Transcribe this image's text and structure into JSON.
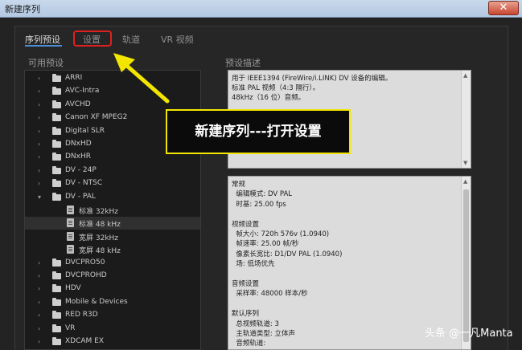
{
  "window": {
    "title": "新建序列",
    "close_glyph": "✕"
  },
  "tabs": [
    {
      "label": "序列预设"
    },
    {
      "label": "设置"
    },
    {
      "label": "轨道"
    },
    {
      "label": "VR 视频"
    }
  ],
  "presets": {
    "label": "可用预设",
    "items": [
      {
        "label": "ARRI",
        "type": "folder",
        "level": 0,
        "expanded": false
      },
      {
        "label": "AVC-Intra",
        "type": "folder",
        "level": 0,
        "expanded": false
      },
      {
        "label": "AVCHD",
        "type": "folder",
        "level": 0,
        "expanded": false
      },
      {
        "label": "Canon XF MPEG2",
        "type": "folder",
        "level": 0,
        "expanded": false
      },
      {
        "label": "Digital SLR",
        "type": "folder",
        "level": 0,
        "expanded": false
      },
      {
        "label": "DNxHD",
        "type": "folder",
        "level": 0,
        "expanded": false
      },
      {
        "label": "DNxHR",
        "type": "folder",
        "level": 0,
        "expanded": false
      },
      {
        "label": "DV - 24P",
        "type": "folder",
        "level": 0,
        "expanded": false
      },
      {
        "label": "DV - NTSC",
        "type": "folder",
        "level": 0,
        "expanded": false
      },
      {
        "label": "DV - PAL",
        "type": "folder",
        "level": 0,
        "expanded": true
      },
      {
        "label": "标准 32kHz",
        "type": "file",
        "level": 1
      },
      {
        "label": "标准 48 kHz",
        "type": "file",
        "level": 1,
        "selected": true
      },
      {
        "label": "宽屏 32kHz",
        "type": "file",
        "level": 1
      },
      {
        "label": "宽屏 48 kHz",
        "type": "file",
        "level": 1
      },
      {
        "label": "DVCPRO50",
        "type": "folder",
        "level": 0,
        "expanded": false
      },
      {
        "label": "DVCPROHD",
        "type": "folder",
        "level": 0,
        "expanded": false
      },
      {
        "label": "HDV",
        "type": "folder",
        "level": 0,
        "expanded": false
      },
      {
        "label": "Mobile & Devices",
        "type": "folder",
        "level": 0,
        "expanded": false
      },
      {
        "label": "RED R3D",
        "type": "folder",
        "level": 0,
        "expanded": false
      },
      {
        "label": "VR",
        "type": "folder",
        "level": 0,
        "expanded": false
      },
      {
        "label": "XDCAM EX",
        "type": "folder",
        "level": 0,
        "expanded": false
      }
    ]
  },
  "description": {
    "label": "预设描述",
    "lines": [
      "用于 IEEE1394 (FireWire/i.LINK) DV 设备的编辑。",
      "标准 PAL 视频（4:3 隔行）。",
      "48kHz（16 位）音频。"
    ]
  },
  "details": {
    "lines": [
      "常规",
      "  编辑模式: DV PAL",
      "  时基: 25.00 fps",
      "",
      "视频设置",
      "  帧大小: 720h 576v (1.0940)",
      "  帧速率: 25.00  帧/秒",
      "  像素长宽比: D1/DV PAL (1.0940)",
      "  场: 低场优先",
      "",
      "音频设置",
      "  采样率: 48000 样本/秒",
      "",
      "默认序列",
      "  总视频轨道: 3",
      "  主轨道类型: 立体声",
      "  音频轨道:"
    ]
  },
  "annotation": {
    "text": "新建序列---打开设置",
    "arrow_color": "#f2e600",
    "highlight_color": "#e02020"
  },
  "watermark": {
    "text": "头条 @一凡Manta"
  }
}
